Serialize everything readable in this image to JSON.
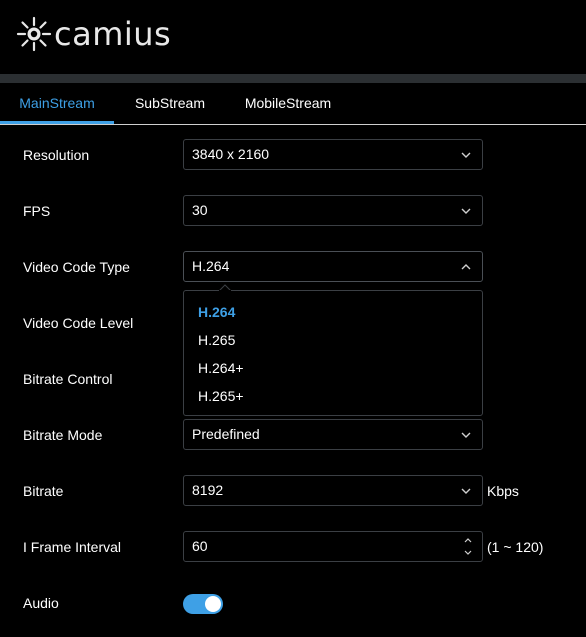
{
  "header": {
    "brand": "camius"
  },
  "tabs": [
    {
      "label": "MainStream",
      "active": true
    },
    {
      "label": "SubStream",
      "active": false
    },
    {
      "label": "MobileStream",
      "active": false
    }
  ],
  "form": {
    "resolution": {
      "label": "Resolution",
      "value": "3840 x 2160"
    },
    "fps": {
      "label": "FPS",
      "value": "30"
    },
    "video_code_type": {
      "label": "Video Code Type",
      "value": "H.264",
      "open": true,
      "options": [
        "H.264",
        "H.265",
        "H.264+",
        "H.265+"
      ]
    },
    "video_code_level": {
      "label": "Video Code Level"
    },
    "bitrate_control": {
      "label": "Bitrate Control"
    },
    "bitrate_mode": {
      "label": "Bitrate Mode",
      "value": "Predefined"
    },
    "bitrate": {
      "label": "Bitrate",
      "value": "8192",
      "unit": "Kbps"
    },
    "iframe_interval": {
      "label": "I Frame Interval",
      "value": "60",
      "range": "(1 ~ 120)"
    },
    "audio": {
      "label": "Audio",
      "enabled": true
    }
  },
  "colors": {
    "accent": "#3ea0e6",
    "background": "#000000",
    "border": "#3b3f44",
    "header_bar": "#2b2f32"
  }
}
